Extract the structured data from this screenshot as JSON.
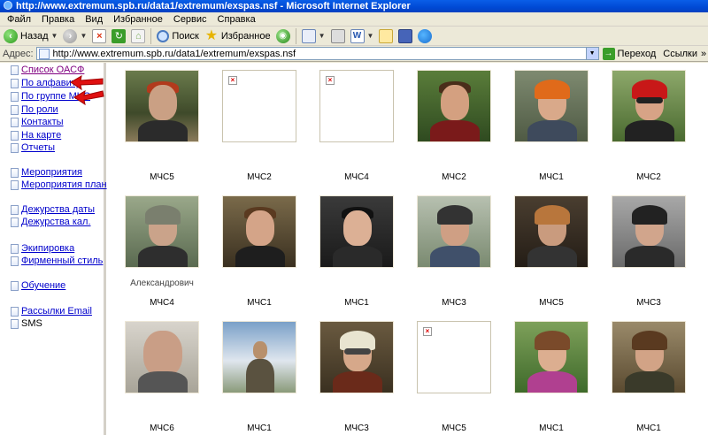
{
  "window": {
    "title": "http://www.extremum.spb.ru/data1/extremum/exspas.nsf - Microsoft Internet Explorer"
  },
  "menu": [
    "Файл",
    "Правка",
    "Вид",
    "Избранное",
    "Сервис",
    "Справка"
  ],
  "toolbar": {
    "back_label": "Назад",
    "search_label": "Поиск",
    "favorites_label": "Избранное"
  },
  "address": {
    "label": "Адрес:",
    "value": "http://www.extremum.spb.ru/data1/extremum/exspas.nsf",
    "go_label": "Переход",
    "links_label": "Ссылки"
  },
  "nav": {
    "items": [
      {
        "label": "Список ОАСФ",
        "link": true
      },
      {
        "label": "По алфавиту",
        "link": true
      },
      {
        "label": "По группе МЧС",
        "link": true
      },
      {
        "label": "По роли",
        "link": true
      },
      {
        "label": "Контакты",
        "link": true
      },
      {
        "label": "На карте",
        "link": true
      },
      {
        "label": "Отчеты",
        "link": true
      },
      {
        "label": "Мероприятия",
        "link": true
      },
      {
        "label": "Мероприятия план",
        "link": true
      },
      {
        "label": "Дежурства даты",
        "link": true
      },
      {
        "label": "Дежурства кал.",
        "link": true
      },
      {
        "label": "Экипировка",
        "link": true
      },
      {
        "label": "Фирменный стиль",
        "link": true
      },
      {
        "label": "Обучение",
        "link": true
      },
      {
        "label": "Рассылки Email",
        "link": true
      },
      {
        "label": "SMS",
        "link": false
      }
    ]
  },
  "people": [
    {
      "name": "",
      "name2": "",
      "group": "МЧС5"
    },
    {
      "name": "",
      "name2": "",
      "group": "МЧС2"
    },
    {
      "name": "",
      "name2": "",
      "group": "МЧС4"
    },
    {
      "name": "",
      "name2": "",
      "group": "МЧС2"
    },
    {
      "name": "",
      "name2": "",
      "group": "МЧС1"
    },
    {
      "name": "",
      "name2": "",
      "group": "МЧС2"
    },
    {
      "name": "",
      "name2": "Александрович",
      "group": "МЧС4"
    },
    {
      "name": "",
      "name2": "",
      "group": "МЧС1"
    },
    {
      "name": "",
      "name2": "",
      "group": "МЧС1"
    },
    {
      "name": "",
      "name2": "",
      "group": "МЧС3"
    },
    {
      "name": "",
      "name2": "",
      "group": "МЧС5"
    },
    {
      "name": "",
      "name2": "",
      "group": "МЧС3"
    },
    {
      "name": "",
      "name2": "",
      "group": "МЧС6"
    },
    {
      "name": "",
      "name2": "",
      "group": "МЧС1"
    },
    {
      "name": "",
      "name2": "",
      "group": "МЧС3"
    },
    {
      "name": "",
      "name2": "",
      "group": "МЧС5"
    },
    {
      "name": "",
      "name2": "",
      "group": "МЧС1"
    },
    {
      "name": "",
      "name2": "",
      "group": "МЧС1"
    }
  ],
  "colors": {
    "link": "#0000cc",
    "visited": "#800080",
    "titlebar": "#0a5ee8"
  }
}
